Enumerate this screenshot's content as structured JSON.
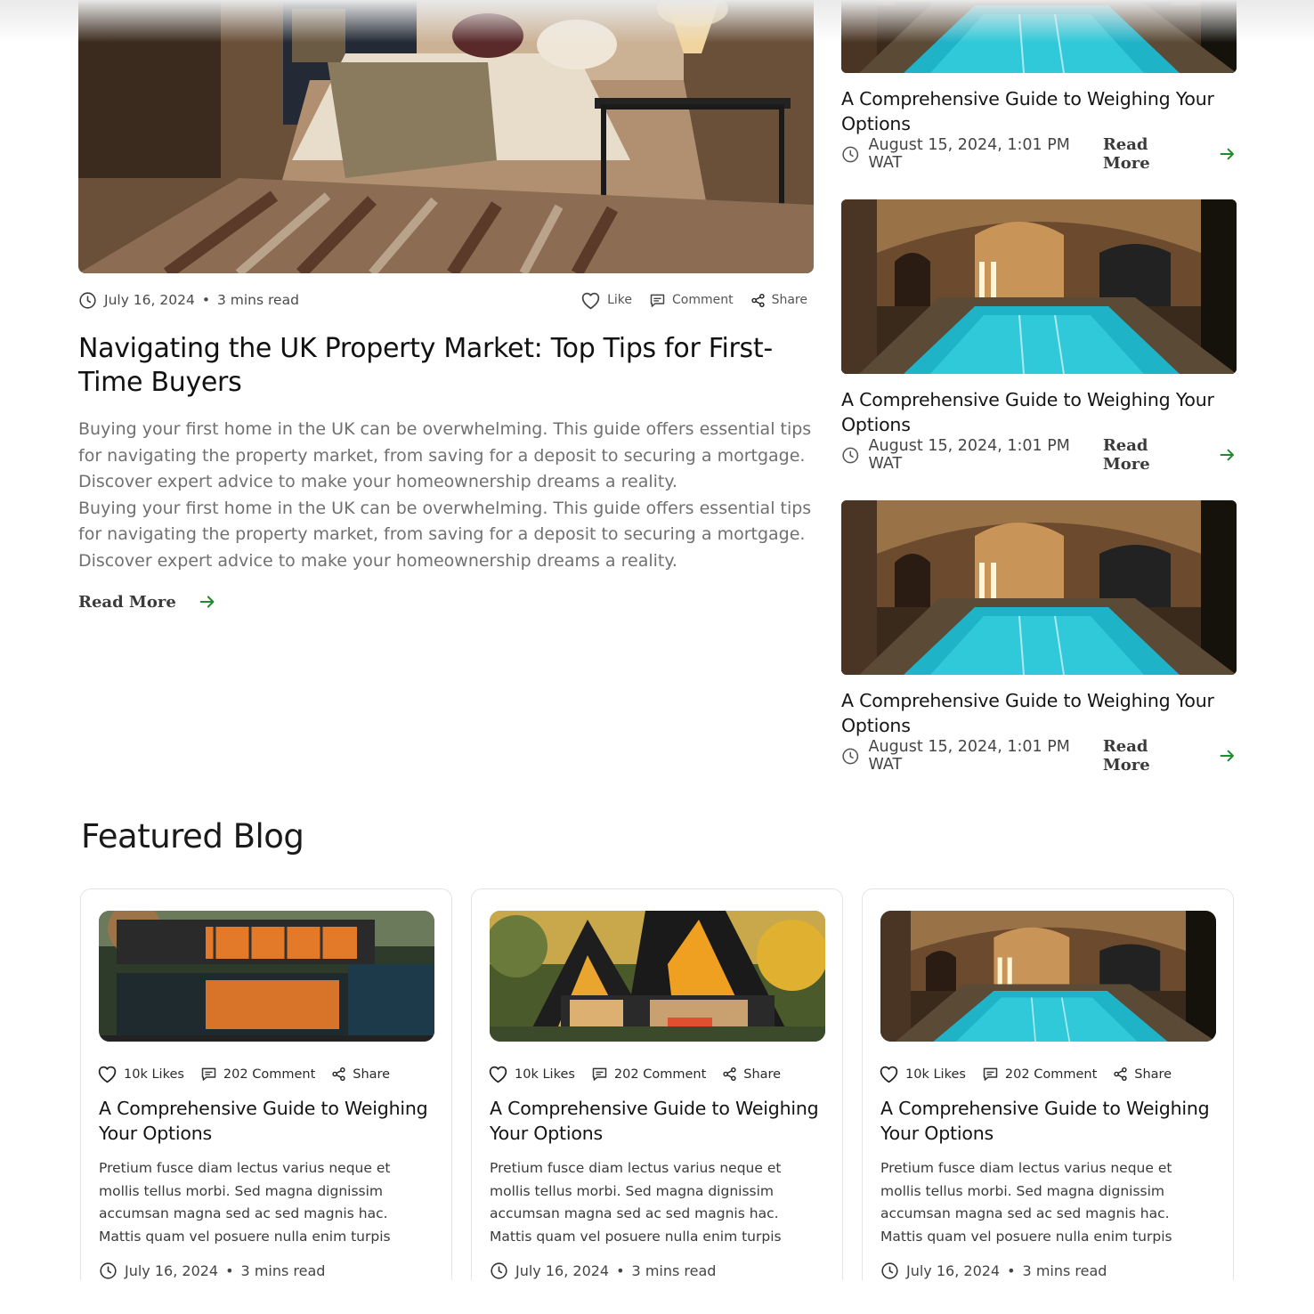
{
  "main_post": {
    "date": "July 16, 2024",
    "separator": "•",
    "read_time": "3 mins read",
    "like_label": "Like",
    "comment_label": "Comment",
    "share_label": "Share",
    "title": "Navigating the UK Property Market: Top Tips for First-Time Buyers",
    "excerpt_1": "Buying your first home in the UK can be overwhelming. This guide offers essential tips for navigating the property market, from saving for a deposit to securing a mortgage. Discover expert advice to make your homeownership dreams a reality.",
    "excerpt_2": "Buying your first home in the UK can be overwhelming. This guide offers essential tips for navigating the property market, from saving for a deposit to securing a mortgage. Discover expert advice to make your homeownership dreams a reality.",
    "read_more": "Read More",
    "image_icon": "bedroom-photo"
  },
  "side_posts": [
    {
      "title": "A Comprehensive Guide to Weighing Your Options",
      "date": "August 15, 2024, 1:01 PM WAT",
      "read_more": "Read More",
      "image_icon": "indoor-pool-photo"
    },
    {
      "title": "A Comprehensive Guide to Weighing Your Options",
      "date": "August 15, 2024, 1:01 PM WAT",
      "read_more": "Read More",
      "image_icon": "indoor-pool-photo"
    },
    {
      "title": "A Comprehensive Guide to Weighing Your Options",
      "date": "August 15, 2024, 1:01 PM WAT",
      "read_more": "Read More",
      "image_icon": "indoor-pool-photo"
    }
  ],
  "featured": {
    "heading": "Featured Blog",
    "cards": [
      {
        "likes": "10k Likes",
        "comments": "202 Comment",
        "share": "Share",
        "title": "A Comprehensive Guide to Weighing Your Options",
        "text": "Pretium fusce diam lectus varius neque et mollis tellus morbi. Sed magna dignissim accumsan magna sed ac sed magnis hac. Mattis quam vel posuere nulla enim turpis",
        "date": "July 16, 2024",
        "separator": "•",
        "read_time": "3 mins read",
        "image_icon": "container-house-photo"
      },
      {
        "likes": "10k Likes",
        "comments": "202 Comment",
        "share": "Share",
        "title": "A Comprehensive Guide to Weighing Your Options",
        "text": "Pretium fusce diam lectus varius neque et mollis tellus morbi. Sed magna dignissim accumsan magna sed ac sed magnis hac. Mattis quam vel posuere nulla enim turpis",
        "date": "July 16, 2024",
        "separator": "•",
        "read_time": "3 mins read",
        "image_icon": "a-frame-house-photo"
      },
      {
        "likes": "10k Likes",
        "comments": "202 Comment",
        "share": "Share",
        "title": "A Comprehensive Guide to Weighing Your Options",
        "text": "Pretium fusce diam lectus varius neque et mollis tellus morbi. Sed magna dignissim accumsan magna sed ac sed magnis hac. Mattis quam vel posuere nulla enim turpis",
        "date": "July 16, 2024",
        "separator": "•",
        "read_time": "3 mins read",
        "image_icon": "indoor-pool-photo"
      }
    ]
  },
  "colors": {
    "accent_green": "#1f8a2e",
    "text_dark": "#1a1a1a",
    "text_muted": "#707070",
    "border": "#e4e4e4"
  }
}
